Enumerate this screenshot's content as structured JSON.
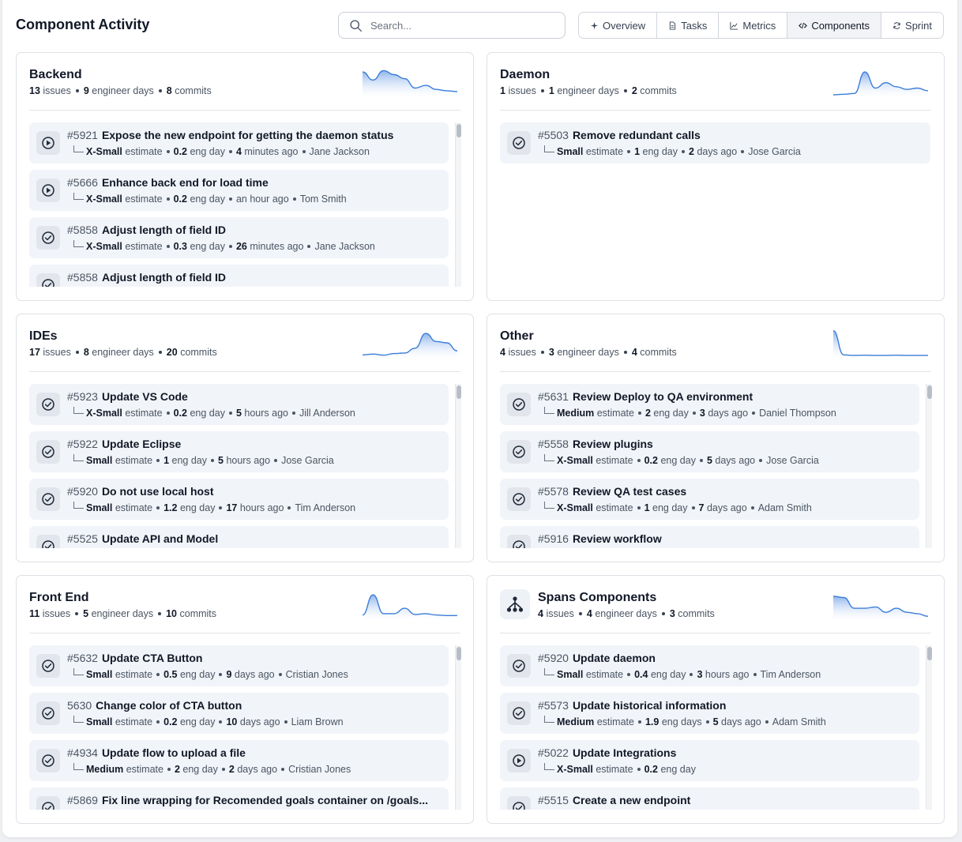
{
  "header": {
    "title": "Component Activity",
    "search_placeholder": "Search...",
    "tabs": [
      {
        "label": "Overview",
        "icon": "sparkle-icon",
        "active": false
      },
      {
        "label": "Tasks",
        "icon": "file-icon",
        "active": false
      },
      {
        "label": "Metrics",
        "icon": "chart-icon",
        "active": false
      },
      {
        "label": "Components",
        "icon": "code-icon",
        "active": true
      },
      {
        "label": "Sprint",
        "icon": "refresh-icon",
        "active": false
      }
    ]
  },
  "colors": {
    "accent": "#3b7dd8",
    "spark_fill_top": "#7aa7e8",
    "spark_fill_bottom": "#ffffff",
    "icon_bg": "#e2e6ec"
  },
  "components": [
    {
      "name": "Backend",
      "stats": {
        "issues": "13",
        "issues_label": "issues",
        "days": "9",
        "days_label": "engineer days",
        "commits": "8",
        "commits_label": "commits"
      },
      "sparkline": [
        0.85,
        0.55,
        0.9,
        0.75,
        0.6,
        0.25,
        0.35,
        0.2,
        0.15,
        0.12
      ],
      "issues": [
        {
          "status": "in-progress",
          "number": "#5921",
          "title": "Expose the new endpoint for getting the daemon status",
          "size": "X-Small",
          "size_label": "estimate",
          "eng": "0.2",
          "eng_label": "eng day",
          "age_num": "4",
          "age_label": "minutes ago",
          "assignee": "Jane Jackson"
        },
        {
          "status": "in-progress",
          "number": "#5666",
          "title": "Enhance back end for load time",
          "size": "X-Small",
          "size_label": "estimate",
          "eng": "0.2",
          "eng_label": "eng day",
          "age_num": "",
          "age_label": "an hour ago",
          "assignee": "Tom Smith"
        },
        {
          "status": "done",
          "number": "#5858",
          "title": "Adjust length of field ID",
          "size": "X-Small",
          "size_label": "estimate",
          "eng": "0.3",
          "eng_label": "eng day",
          "age_num": "26",
          "age_label": "minutes ago",
          "assignee": "Jane Jackson"
        },
        {
          "status": "done",
          "number": "#5858",
          "title": "Adjust length of field ID",
          "size": "",
          "size_label": "",
          "eng": "",
          "eng_label": "",
          "age_num": "",
          "age_label": "",
          "assignee": ""
        }
      ]
    },
    {
      "name": "Daemon",
      "stats": {
        "issues": "1",
        "issues_label": "issues",
        "days": "1",
        "days_label": "engineer days",
        "commits": "2",
        "commits_label": "commits"
      },
      "sparkline": [
        0.0,
        0.02,
        0.05,
        0.85,
        0.25,
        0.45,
        0.3,
        0.2,
        0.25,
        0.15
      ],
      "issues": [
        {
          "status": "done",
          "number": "#5503",
          "title": "Remove redundant calls",
          "size": "Small",
          "size_label": "estimate",
          "eng": "1",
          "eng_label": "eng day",
          "age_num": "2",
          "age_label": "days ago",
          "assignee": "Jose Garcia"
        }
      ]
    },
    {
      "name": "IDEs",
      "stats": {
        "issues": "17",
        "issues_label": "issues",
        "days": "8",
        "days_label": "engineer days",
        "commits": "20",
        "commits_label": "commits"
      },
      "sparkline": [
        0.05,
        0.08,
        0.04,
        0.1,
        0.12,
        0.3,
        0.85,
        0.55,
        0.5,
        0.2
      ],
      "issues": [
        {
          "status": "done",
          "number": "#5923",
          "title": "Update VS Code",
          "size": "X-Small",
          "size_label": "estimate",
          "eng": "0.2",
          "eng_label": "eng day",
          "age_num": "5",
          "age_label": "hours ago",
          "assignee": "Jill Anderson"
        },
        {
          "status": "done",
          "number": "#5922",
          "title": "Update Eclipse",
          "size": "Small",
          "size_label": "estimate",
          "eng": "1",
          "eng_label": "eng day",
          "age_num": "5",
          "age_label": "hours ago",
          "assignee": "Jose Garcia"
        },
        {
          "status": "done",
          "number": "#5920",
          "title": "Do not use local host",
          "size": "Small",
          "size_label": "estimate",
          "eng": "1.2",
          "eng_label": "eng day",
          "age_num": "17",
          "age_label": "hours ago",
          "assignee": "Tim Anderson"
        },
        {
          "status": "done",
          "number": "#5525",
          "title": "Update API and Model",
          "size": "",
          "size_label": "",
          "eng": "",
          "eng_label": "",
          "age_num": "",
          "age_label": "",
          "assignee": ""
        }
      ]
    },
    {
      "name": "Other",
      "stats": {
        "issues": "4",
        "issues_label": "issues",
        "days": "3",
        "days_label": "engineer days",
        "commits": "4",
        "commits_label": "commits"
      },
      "sparkline": [
        0.95,
        0.05,
        0.03,
        0.04,
        0.03,
        0.03,
        0.04,
        0.03,
        0.03,
        0.03
      ],
      "issues": [
        {
          "status": "done",
          "number": "#5631",
          "title": "Review Deploy to QA environment",
          "size": "Medium",
          "size_label": "estimate",
          "eng": "2",
          "eng_label": "eng day",
          "age_num": "3",
          "age_label": "days ago",
          "assignee": "Daniel Thompson"
        },
        {
          "status": "done",
          "number": "#5558",
          "title": "Review plugins",
          "size": "X-Small",
          "size_label": "estimate",
          "eng": "0.2",
          "eng_label": "eng day",
          "age_num": "5",
          "age_label": "days ago",
          "assignee": "Jose Garcia"
        },
        {
          "status": "done",
          "number": "#5578",
          "title": "Review QA test cases",
          "size": "X-Small",
          "size_label": "estimate",
          "eng": "1",
          "eng_label": "eng day",
          "age_num": "7",
          "age_label": "days ago",
          "assignee": "Adam Smith"
        },
        {
          "status": "done",
          "number": "#5916",
          "title": "Review workflow",
          "size": "",
          "size_label": "",
          "eng": "",
          "eng_label": "",
          "age_num": "",
          "age_label": "",
          "assignee": ""
        }
      ]
    },
    {
      "name": "Front End",
      "stats": {
        "issues": "11",
        "issues_label": "issues",
        "days": "5",
        "days_label": "engineer days",
        "commits": "10",
        "commits_label": "commits"
      },
      "sparkline": [
        0.1,
        0.85,
        0.15,
        0.15,
        0.35,
        0.12,
        0.15,
        0.1,
        0.08,
        0.08
      ],
      "issues": [
        {
          "status": "done",
          "number": "#5632",
          "title": "Update CTA Button",
          "size": "Small",
          "size_label": "estimate",
          "eng": "0.5",
          "eng_label": "eng day",
          "age_num": "9",
          "age_label": "days ago",
          "assignee": "Cristian Jones"
        },
        {
          "status": "done",
          "number": "5630",
          "title": "Change color of CTA button",
          "size": "Small",
          "size_label": "estimate",
          "eng": "0.2",
          "eng_label": "eng day",
          "age_num": "10",
          "age_label": "days ago",
          "assignee": "Liam Brown"
        },
        {
          "status": "done",
          "number": "#4934",
          "title": "Update flow to upload a file",
          "size": "Medium",
          "size_label": "estimate",
          "eng": "2",
          "eng_label": "eng day",
          "age_num": "2",
          "age_label": "days ago",
          "assignee": "Cristian Jones"
        },
        {
          "status": "done",
          "number": "#5869",
          "title": "Fix line wrapping for Recomended goals container on /goals...",
          "size": "",
          "size_label": "",
          "eng": "",
          "eng_label": "",
          "age_num": "",
          "age_label": "",
          "assignee": ""
        }
      ]
    },
    {
      "name": "Spans Components",
      "avatar_icon": "hierarchy-icon",
      "stats": {
        "issues": "4",
        "issues_label": "issues",
        "days": "4",
        "days_label": "engineer days",
        "commits": "3",
        "commits_label": "commits"
      },
      "sparkline": [
        0.8,
        0.75,
        0.35,
        0.35,
        0.4,
        0.2,
        0.35,
        0.2,
        0.15,
        0.05
      ],
      "issues": [
        {
          "status": "done",
          "number": "#5920",
          "title": "Update daemon",
          "size": "Small",
          "size_label": "estimate",
          "eng": "0.4",
          "eng_label": "eng day",
          "age_num": "3",
          "age_label": "hours ago",
          "assignee": "Tim Anderson"
        },
        {
          "status": "done",
          "number": "#5573",
          "title": "Update historical information",
          "size": "Medium",
          "size_label": "estimate",
          "eng": "1.9",
          "eng_label": "eng days",
          "age_num": "5",
          "age_label": "days ago",
          "assignee": "Adam Smith"
        },
        {
          "status": "in-progress",
          "number": "#5022",
          "title": "Update Integrations",
          "size": "X-Small",
          "size_label": "estimate",
          "eng": "0.2",
          "eng_label": "eng day",
          "age_num": "",
          "age_label": "",
          "assignee": ""
        },
        {
          "status": "done",
          "number": "#5515",
          "title": "Create a new endpoint",
          "size": "",
          "size_label": "",
          "eng": "",
          "eng_label": "",
          "age_num": "",
          "age_label": "",
          "assignee": ""
        }
      ]
    }
  ]
}
